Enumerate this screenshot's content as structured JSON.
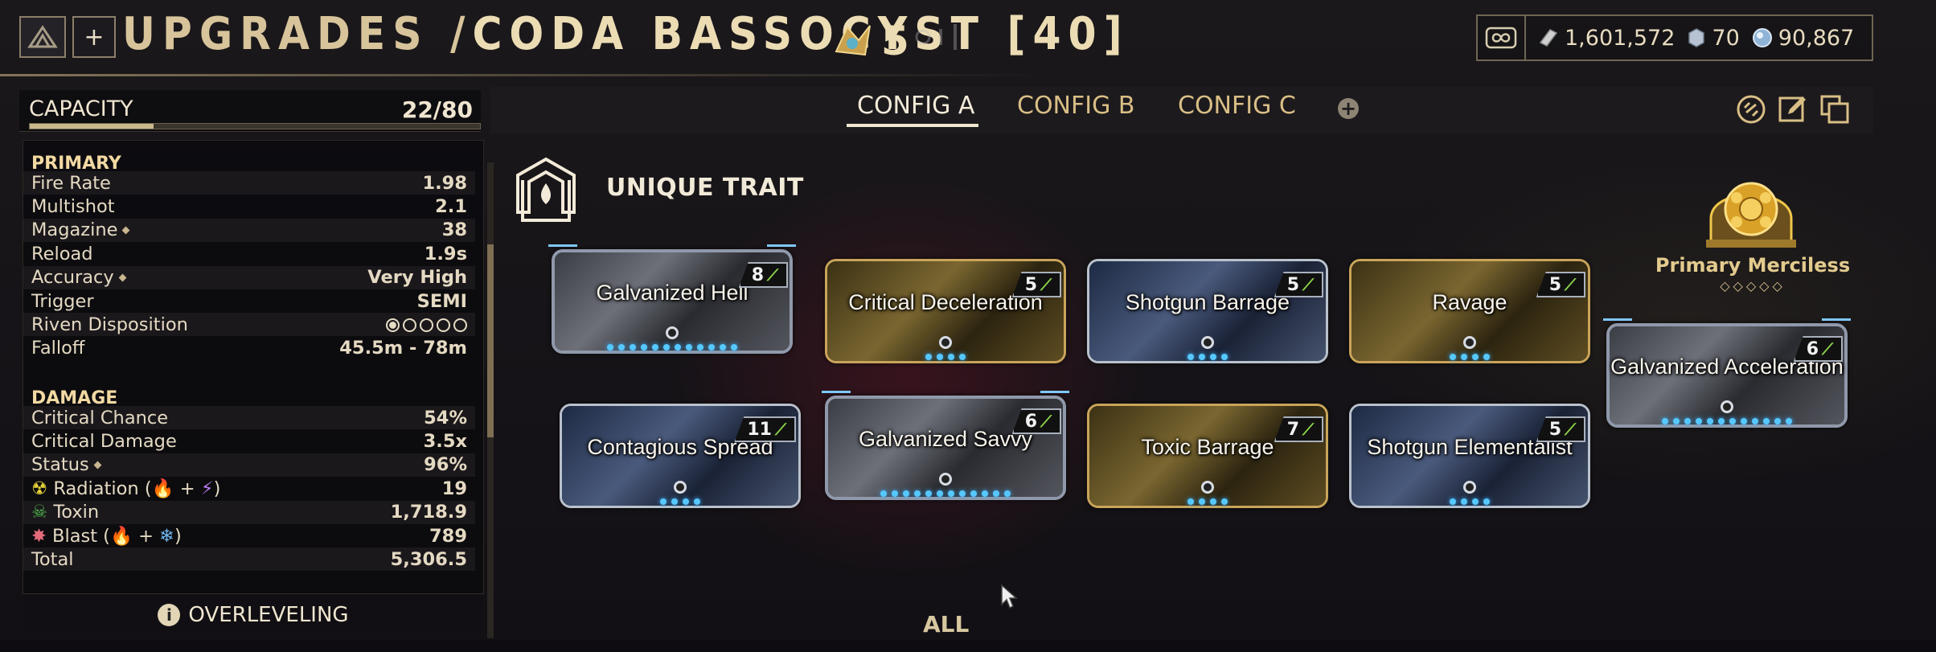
{
  "header": {
    "title_prefix": "UPGRADES /",
    "title_item": "CODA BASSOCYST [40]",
    "forma_count": "5"
  },
  "currencies": {
    "credits": "1,601,572",
    "platinum": "70",
    "endo": "90,867"
  },
  "capacity": {
    "label": "CAPACITY",
    "value": "22/80",
    "fill_fraction": 0.275
  },
  "stats": {
    "primary_heading": "PRIMARY",
    "primary": [
      {
        "label": "Fire Rate",
        "value": "1.98"
      },
      {
        "label": "Multishot",
        "value": "2.1"
      },
      {
        "label": "Magazine",
        "value": "38"
      },
      {
        "label": "Reload",
        "value": "1.9s"
      },
      {
        "label": "Accuracy",
        "value": "Very High"
      },
      {
        "label": "Trigger",
        "value": "SEMI"
      },
      {
        "label": "Riven Disposition",
        "value": ""
      },
      {
        "label": "Falloff",
        "value": "45.5m - 78m"
      }
    ],
    "damage_heading": "DAMAGE",
    "damage": [
      {
        "label": "Critical Chance",
        "value": "54%"
      },
      {
        "label": "Critical Damage",
        "value": "3.5x"
      },
      {
        "label": "Status",
        "value": "96%"
      },
      {
        "label": "Radiation (",
        "value": "19"
      },
      {
        "label": "Toxin",
        "value": "1,718.9"
      },
      {
        "label": "Blast (",
        "value": "789"
      },
      {
        "label": "Total",
        "value": "5,306.5"
      }
    ],
    "riven_disposition_level": 1,
    "riven_disposition_max": 5
  },
  "overleveling": "OVERLEVELING",
  "configs": {
    "tabs": [
      "CONFIG A",
      "CONFIG B",
      "CONFIG C"
    ],
    "active": 0
  },
  "unique_trait": "UNIQUE TRAIT",
  "mods": [
    {
      "name": "Galvanized Hell",
      "rank": "8",
      "style": "galv"
    },
    {
      "name": "Critical Deceleration",
      "rank": "5",
      "style": "gold"
    },
    {
      "name": "Shotgun Barrage",
      "rank": "5",
      "style": "silver"
    },
    {
      "name": "Ravage",
      "rank": "5",
      "style": "gold"
    },
    {
      "name": "Contagious Spread",
      "rank": "11",
      "style": "silver"
    },
    {
      "name": "Galvanized Savvy",
      "rank": "6",
      "style": "galv"
    },
    {
      "name": "Toxic Barrage",
      "rank": "7",
      "style": "gold"
    },
    {
      "name": "Shotgun Elementalist",
      "rank": "5",
      "style": "silver"
    },
    {
      "name": "Galvanized Acceleration",
      "rank": "6",
      "style": "galv"
    }
  ],
  "arcane": {
    "name": "Primary Merciless",
    "diamonds": "◇◇◇◇◇"
  },
  "filter_label": "ALL",
  "colors": {
    "gold_text": "#d9bf86",
    "polarity_green": "#8fd74a",
    "mod_glow": "#56c8ff"
  }
}
